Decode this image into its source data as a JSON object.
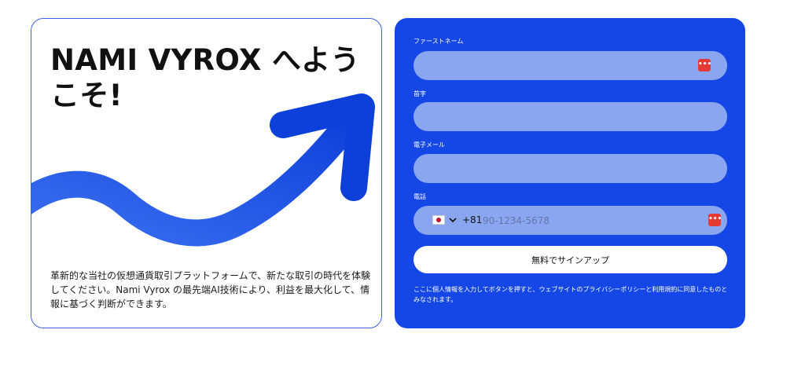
{
  "welcome": {
    "title": "NAMI VYROX へようこそ!",
    "description": "革新的な当社の仮想通貨取引プラットフォームで、新たな取引の時代を体験してください。Nami Vyrox の最先端AI技術により、利益を最大化して、情報に基づく判断ができます。"
  },
  "form": {
    "first_name_label": "ファーストネーム",
    "last_name_label": "苗字",
    "email_label": "電子メール",
    "phone_label": "電話",
    "dial_code": "+81",
    "phone_placeholder": "90-1234-5678",
    "badge_glyph": "•••",
    "signup_label": "無料でサインアップ",
    "consent": "ここに個人情報を入力してボタンを押すと、ウェブサイトのプライバシーポリシーと利用規約に同意したものとみなされます。"
  },
  "icons": {
    "arrow": "growth-arrow-icon",
    "flag": "japan-flag-icon",
    "chevron": "chevron-down-icon",
    "badge": "password-manager-icon"
  },
  "colors": {
    "panel": "#1447e6",
    "field": "#8aa6f0",
    "arrow": "#1f4fe0",
    "badge": "#e53935"
  }
}
